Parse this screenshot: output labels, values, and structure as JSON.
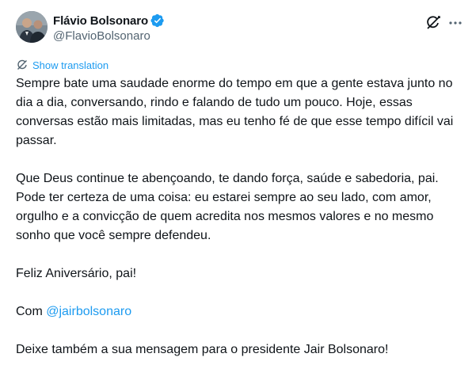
{
  "author": {
    "display_name": "Flávio Bolsonaro",
    "handle": "@FlavioBolsonaro",
    "verified": true,
    "verified_color": "#1d9bf0"
  },
  "actions": {
    "grok_icon": "grok-icon",
    "more_icon": "more-horizontal-icon"
  },
  "translation": {
    "label": "Show translation",
    "icon": "translate-icon",
    "color": "#1d9bf0"
  },
  "post": {
    "para1": "Sempre bate uma saudade enorme do tempo em que a gente estava junto no dia a dia, conversando, rindo e falando de tudo um pouco. Hoje, essas conversas estão mais limitadas, mas eu tenho fé de que esse tempo difícil vai passar.",
    "para2": "Que Deus continue te abençoando, te dando força, saúde e sabedoria, pai. Pode ter certeza de uma coisa: eu estarei sempre ao seu lado, com amor, orgulho e a convicção de quem acredita nos mesmos valores e no mesmo sonho que você sempre defendeu.",
    "para3": "Feliz Aniversário, pai!",
    "para4_prefix": "Com ",
    "para4_mention": "@jairbolsonaro",
    "para5": "Deixe também a sua mensagem para o presidente Jair Bolsonaro!"
  },
  "colors": {
    "text": "#0f1419",
    "secondary": "#536471",
    "link": "#1d9bf0"
  }
}
